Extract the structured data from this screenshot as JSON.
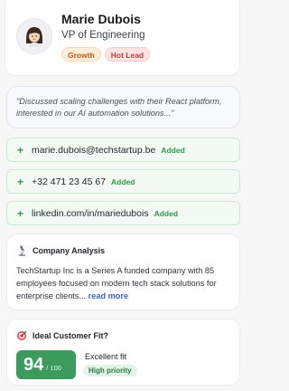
{
  "profile": {
    "name": "Marie Dubois",
    "role": "VP of Engineering",
    "tags": [
      "Growth",
      "Hot Lead"
    ],
    "avatar_icon": "woman-emoji-icon"
  },
  "quote": {
    "text": "\"Discussed scaling challenges with their React platform, interested in our AI automation solutions...\""
  },
  "contacts": [
    {
      "value": "marie.dubois@techstartup.be",
      "status": "Added"
    },
    {
      "value": "+32 471 23 45 67",
      "status": "Added"
    },
    {
      "value": "linkedin.com/in/mariedubois",
      "status": "Added"
    }
  ],
  "analysis": {
    "title": "Company Analysis",
    "icon": "microscope-icon",
    "body": "TechStartup Inc is a Series A funded company with 85 employees focused on modern tech stack solutions for enterprise clients...",
    "read_more": "read more"
  },
  "fit": {
    "title": "Ideal Customer Fit?",
    "icon": "target-icon",
    "score": "94",
    "score_max": "/ 100",
    "label": "Excellent fit",
    "priority": "High priority",
    "score_color": "#3a9b5c"
  }
}
